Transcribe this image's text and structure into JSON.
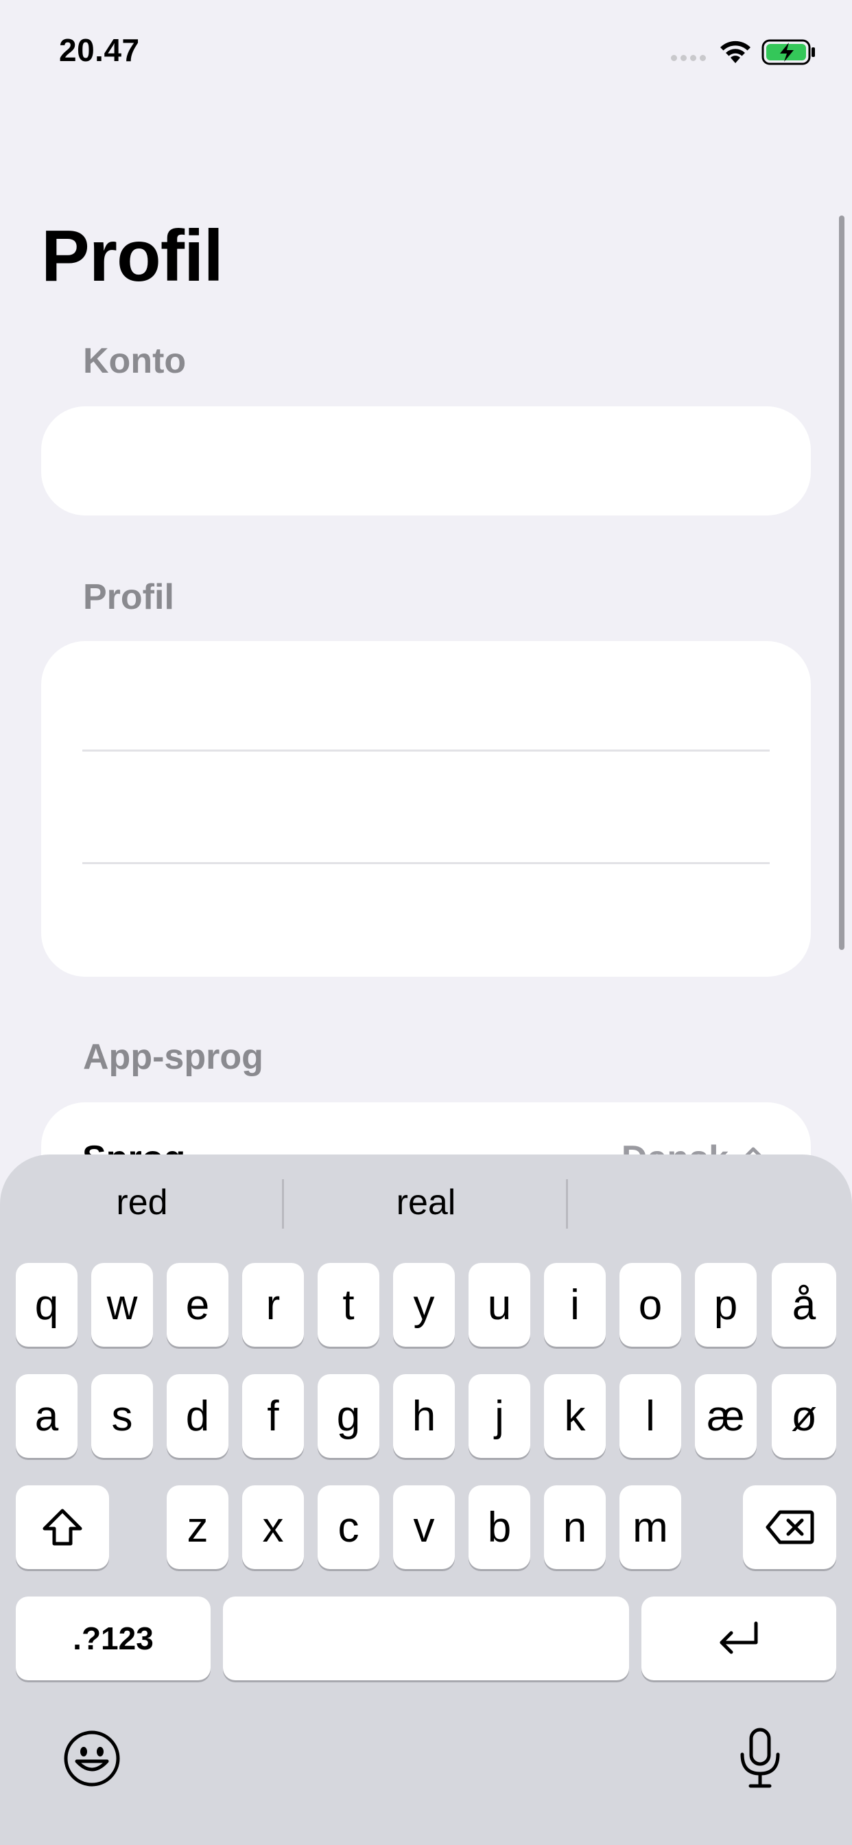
{
  "status_bar": {
    "time": "20.47"
  },
  "header": {
    "title": "Profil"
  },
  "sections": {
    "account": {
      "header": "Konto"
    },
    "profile": {
      "header": "Profil"
    },
    "language": {
      "header": "App-sprog",
      "row_label": "Sprog",
      "row_value": "Dansk"
    }
  },
  "keyboard": {
    "suggestions": [
      "red",
      "real",
      ""
    ],
    "row1": [
      "q",
      "w",
      "e",
      "r",
      "t",
      "y",
      "u",
      "i",
      "o",
      "p",
      "å"
    ],
    "row2": [
      "a",
      "s",
      "d",
      "f",
      "g",
      "h",
      "j",
      "k",
      "l",
      "æ",
      "ø"
    ],
    "row3": [
      "z",
      "x",
      "c",
      "v",
      "b",
      "n",
      "m"
    ],
    "numbers_key": ".?123",
    "space_label": ""
  },
  "icons": {
    "wifi": "wifi-icon",
    "battery": "battery-charging-icon",
    "shift": "shift-icon",
    "delete": "delete-icon",
    "return": "return-icon",
    "emoji": "emoji-icon",
    "mic": "microphone-icon",
    "chevron": "chevron-up-icon"
  },
  "colors": {
    "battery_fill": "#34c759",
    "background": "#f1f0f6",
    "keyboard_bg": "#d6d7dd"
  }
}
